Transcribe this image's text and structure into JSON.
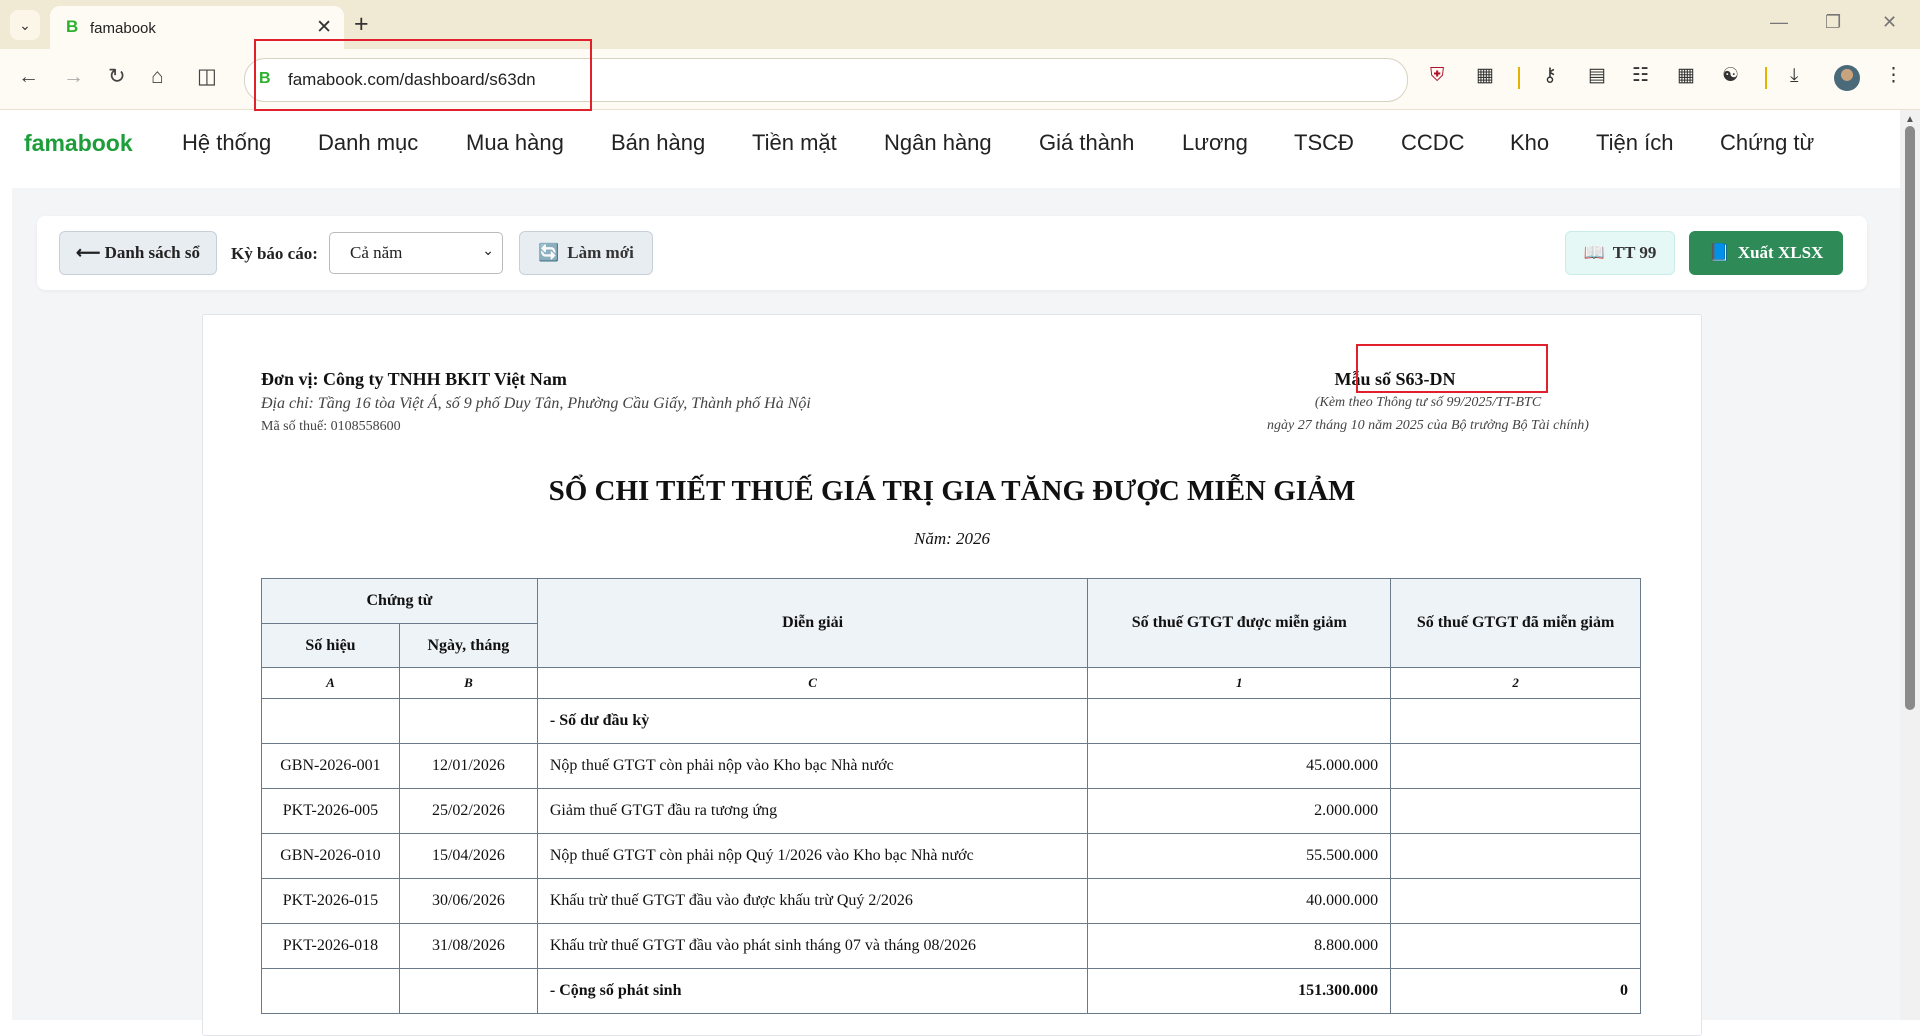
{
  "browser": {
    "tab_title": "famabook",
    "tab_favicon": "B",
    "url": "famabook.com/dashboard/s63dn"
  },
  "app": {
    "brand": "famabook",
    "menu": [
      "Hệ thống",
      "Danh mục",
      "Mua hàng",
      "Bán hàng",
      "Tiền mặt",
      "Ngân hàng",
      "Giá thành",
      "Lương",
      "TSCĐ",
      "CCDC",
      "Kho",
      "Tiện ích",
      "Chứng từ"
    ]
  },
  "toolbar": {
    "back_label": "⟵ Danh sách sổ",
    "period_label": "Kỳ báo cáo:",
    "period_value": "Cả năm",
    "refresh_label": "Làm mới",
    "tt_label": "TT 99",
    "export_label": "Xuất XLSX"
  },
  "report": {
    "unit": "Đơn vị: Công ty TNHH BKIT Việt Nam",
    "address": "Địa chỉ: Tầng 16 tòa Việt Á, số 9 phố Duy Tân, Phường Cầu Giấy, Thành phố Hà Nội",
    "tax_code": "Mã số thuế: 0108558600",
    "form_no": "Mẫu số S63-DN",
    "form_note_1": "(Kèm theo Thông tư số 99/2025/TT-BTC",
    "form_note_2": "ngày 27 tháng 10 năm 2025 của Bộ trưởng Bộ Tài chính)",
    "title": "SỔ CHI TIẾT THUẾ GIÁ TRỊ GIA TĂNG ĐƯỢC MIỄN GIẢM",
    "year": "Năm: 2026",
    "headers": {
      "voucher": "Chứng từ",
      "number": "Số hiệu",
      "date": "Ngày, tháng",
      "description": "Diễn giải",
      "exempt": "Số thuế GTGT được miễn giảm",
      "exempted": "Số thuế GTGT đã miễn giảm"
    },
    "codes": [
      "A",
      "B",
      "C",
      "1",
      "2"
    ],
    "opening_label": "- Số dư đầu kỳ",
    "rows": [
      {
        "no": "GBN-2026-001",
        "date": "12/01/2026",
        "desc": "Nộp thuế GTGT còn phải nộp vào Kho bạc Nhà nước",
        "exempt": "45.000.000",
        "exempted": ""
      },
      {
        "no": "PKT-2026-005",
        "date": "25/02/2026",
        "desc": "Giảm thuế GTGT đầu ra tương ứng",
        "exempt": "2.000.000",
        "exempted": ""
      },
      {
        "no": "GBN-2026-010",
        "date": "15/04/2026",
        "desc": "Nộp thuế GTGT còn phải nộp Quý 1/2026 vào Kho bạc Nhà nước",
        "exempt": "55.500.000",
        "exempted": ""
      },
      {
        "no": "PKT-2026-015",
        "date": "30/06/2026",
        "desc": "Khấu trừ thuế GTGT đầu vào được khấu trừ Quý 2/2026",
        "exempt": "40.000.000",
        "exempted": ""
      },
      {
        "no": "PKT-2026-018",
        "date": "31/08/2026",
        "desc": "Khấu trừ thuế GTGT đầu vào phát sinh tháng 07 và tháng 08/2026",
        "exempt": "8.800.000",
        "exempted": ""
      }
    ],
    "total_label": "- Cộng số phát sinh",
    "total_exempt": "151.300.000",
    "total_exempted": "0"
  },
  "colors": {
    "brand": "#1e9e3a",
    "export_button": "#2e8b57",
    "highlight_box": "#e0202a"
  }
}
